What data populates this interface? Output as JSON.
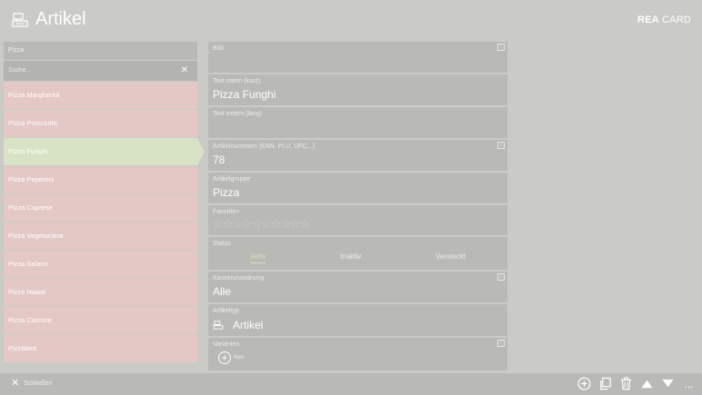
{
  "header": {
    "title": "Artikel",
    "brand_bold": "REA",
    "brand_rest": " CARD"
  },
  "sidebar": {
    "filter_value": "Pizza",
    "search_placeholder": "Suche...",
    "items": [
      {
        "label": "Pizza Margherita",
        "selected": false
      },
      {
        "label": "Pizza Prosciutto",
        "selected": false
      },
      {
        "label": "Pizza Funghi",
        "selected": true
      },
      {
        "label": "Pizza Peperoni",
        "selected": false
      },
      {
        "label": "Pizza Caprese",
        "selected": false
      },
      {
        "label": "Pizza Vegetariana",
        "selected": false
      },
      {
        "label": "Pizza Salami",
        "selected": false
      },
      {
        "label": "Pizza Hawai",
        "selected": false
      },
      {
        "label": "Pizza Calzone",
        "selected": false
      },
      {
        "label": "Pizzabrot",
        "selected": false
      }
    ]
  },
  "detail": {
    "bild_label": "Bild",
    "text_intern_label": "Text intern (kurz)",
    "text_intern_value": "Pizza Funghi",
    "text_extern_label": "Text extern (lang)",
    "text_extern_value": "",
    "artikelnummern_label": "Artikelnummern (EAN, PLU, UPC,..)",
    "artikelnummern_value": "78",
    "artikelgruppe_label": "Artikelgruppe",
    "artikelgruppe_value": "Pizza",
    "favoriten_label": "Favoriten",
    "favoriten_stars": "☆☆☆☆☆☆☆☆☆☆",
    "status_label": "Status",
    "status_options": [
      "Aktiv",
      "Inaktiv",
      "Versteckt"
    ],
    "status_selected": "Aktiv",
    "kassenzuordnung_label": "Kassenzuordnung",
    "kassenzuordnung_value": "Alle",
    "artikeltyp_label": "Artikeltyp",
    "artikeltyp_value": "Artikel",
    "varianten_label": "Varianten",
    "neu_label": "Neu",
    "info_glyph": "i"
  },
  "footer": {
    "close_label": "Schließen",
    "more_glyph": "..."
  },
  "colors": {
    "background": "#cacac7",
    "panel": "#b9b9b6",
    "item": "#e3c8c5",
    "selected_item": "#d7e3c4",
    "status_active": "#d0e5ae"
  }
}
